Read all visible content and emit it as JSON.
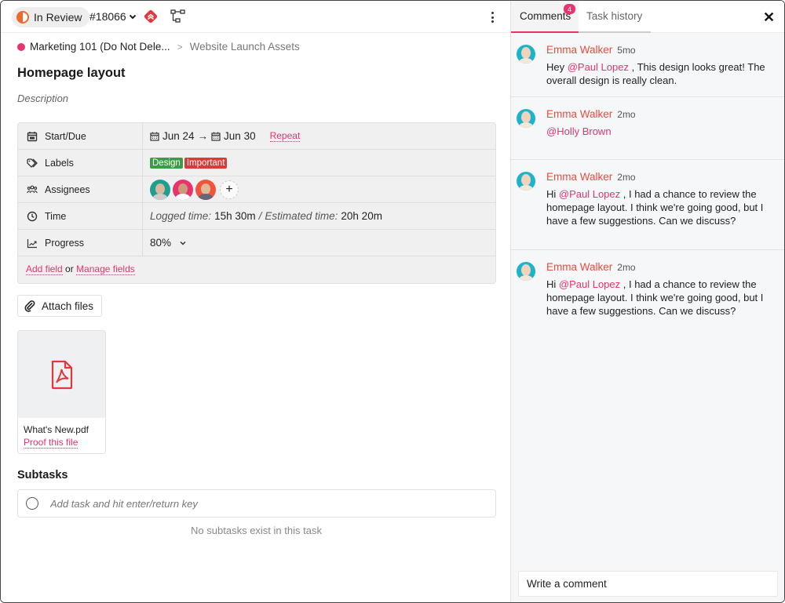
{
  "header": {
    "status": "In Review",
    "task_id": "#18066",
    "status_color": "#f06a2c",
    "priority_color": "#e0383e"
  },
  "breadcrumb": {
    "project": "Marketing 101 (Do Not Dele...",
    "separator": ">",
    "list": "Website Launch Assets",
    "project_color": "#e8336d"
  },
  "task": {
    "title": "Homepage layout",
    "description_placeholder": "Description"
  },
  "fields": {
    "start_due": {
      "label": "Start/Due",
      "start": "Jun 24",
      "arrow": "→",
      "due": "Jun 30",
      "repeat": "Repeat"
    },
    "labels": {
      "label": "Labels",
      "tags": [
        {
          "text": "Design",
          "color": "#3a9c47"
        },
        {
          "text": "Important",
          "color": "#d93a3a"
        }
      ]
    },
    "assignees": {
      "label": "Assignees",
      "add": "+",
      "avatar_colors": [
        "#1f9e8f",
        "#e8336d",
        "#f0553a"
      ]
    },
    "time": {
      "label": "Time",
      "logged_label": "Logged time:",
      "logged_value": "15h 30m",
      "sep": "/",
      "estimated_label": "Estimated time:",
      "estimated_value": "20h 20m"
    },
    "progress": {
      "label": "Progress",
      "value": "80%"
    },
    "add_field": "Add field",
    "or": "or",
    "manage_fields": "Manage fields"
  },
  "attachments": {
    "attach_label": "Attach files",
    "files": [
      {
        "name": "What's New.pdf",
        "action": "Proof this file"
      }
    ]
  },
  "subtasks": {
    "title": "Subtasks",
    "placeholder": "Add task and hit enter/return key",
    "empty": "No subtasks exist in this task"
  },
  "panel": {
    "tabs": [
      {
        "label": "Comments",
        "badge": "4"
      },
      {
        "label": "Task history"
      }
    ],
    "accent": "#e8336d",
    "comments": [
      {
        "author": "Emma Walker",
        "time": "5mo",
        "parts": [
          {
            "t": "Hey ",
            "m": false
          },
          {
            "t": "@Paul Lopez",
            "m": true
          },
          {
            "t": " , This design looks great! The overall design is really clean.",
            "m": false
          }
        ]
      },
      {
        "author": "Emma Walker",
        "time": "2mo",
        "parts": [
          {
            "t": "@Holly Brown",
            "m": true
          }
        ]
      },
      {
        "author": "Emma Walker",
        "time": "2mo",
        "parts": [
          {
            "t": "Hi ",
            "m": false
          },
          {
            "t": "@Paul Lopez",
            "m": true
          },
          {
            "t": " , I had a chance to review the homepage layout. I think we're going good, but I have a few suggestions. Can we discuss?",
            "m": false
          }
        ]
      },
      {
        "author": "Emma Walker",
        "time": "2mo",
        "parts": [
          {
            "t": "Hi ",
            "m": false
          },
          {
            "t": "@Paul Lopez",
            "m": true
          },
          {
            "t": " , I had a chance to review the homepage layout. I think we're going good, but I have a few suggestions. Can we discuss?",
            "m": false
          }
        ]
      }
    ],
    "write_placeholder": "Write a comment"
  }
}
